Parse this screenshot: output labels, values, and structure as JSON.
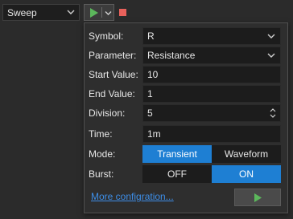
{
  "toolbar": {
    "sweep_value": "Sweep"
  },
  "popup": {
    "symbol": {
      "label": "Symbol:",
      "value": "R"
    },
    "parameter": {
      "label": "Parameter:",
      "value": "Resistance"
    },
    "start": {
      "label": "Start Value:",
      "value": "10"
    },
    "end": {
      "label": "End Value:",
      "value": "1"
    },
    "division": {
      "label": "Division:",
      "value": "5"
    },
    "time": {
      "label": "Time:",
      "value": "1m"
    },
    "mode": {
      "label": "Mode:",
      "options": [
        "Transient",
        "Waveform"
      ],
      "selected": "Transient"
    },
    "burst": {
      "label": "Burst:",
      "options": [
        "OFF",
        "ON"
      ],
      "selected": "ON"
    },
    "more_link": "More configration..."
  },
  "colors": {
    "accent": "#1e7fd3",
    "play_green": "#5cb85c",
    "stop_red": "#e8615b",
    "link": "#3d8ee8"
  }
}
